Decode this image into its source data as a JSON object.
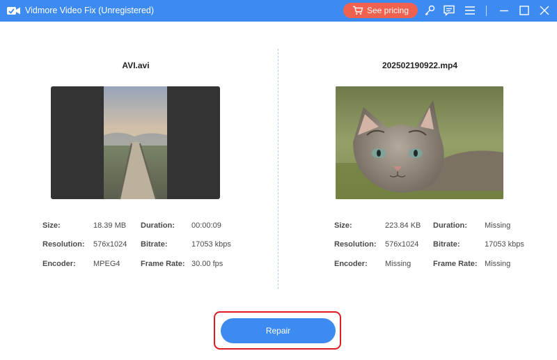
{
  "window": {
    "title": "Vidmore Video Fix (Unregistered)",
    "pricing_label": "See pricing"
  },
  "colors": {
    "accent": "#3d8bf0",
    "pricing": "#f0624f",
    "highlight": "#e0181f"
  },
  "icons": {
    "app": "video-camera-icon",
    "cart": "cart-icon",
    "key": "key-icon",
    "feedback": "chat-icon",
    "menu": "hamburger-menu-icon",
    "minimize": "minimize-icon",
    "maximize": "maximize-icon",
    "close": "close-icon"
  },
  "left": {
    "file_name": "AVI.avi",
    "fields": {
      "size_label": "Size:",
      "size": "18.39 MB",
      "duration_label": "Duration:",
      "duration": "00:00:09",
      "resolution_label": "Resolution:",
      "resolution": "576x1024",
      "bitrate_label": "Bitrate:",
      "bitrate": "17053 kbps",
      "encoder_label": "Encoder:",
      "encoder": "MPEG4",
      "framerate_label": "Frame Rate:",
      "framerate": "30.00 fps"
    }
  },
  "right": {
    "file_name": "202502190922.mp4",
    "fields": {
      "size_label": "Size:",
      "size": "223.84 KB",
      "duration_label": "Duration:",
      "duration": "Missing",
      "resolution_label": "Resolution:",
      "resolution": "576x1024",
      "bitrate_label": "Bitrate:",
      "bitrate": "17053 kbps",
      "encoder_label": "Encoder:",
      "encoder": "Missing",
      "framerate_label": "Frame Rate:",
      "framerate": "Missing"
    }
  },
  "repair_label": "Repair"
}
